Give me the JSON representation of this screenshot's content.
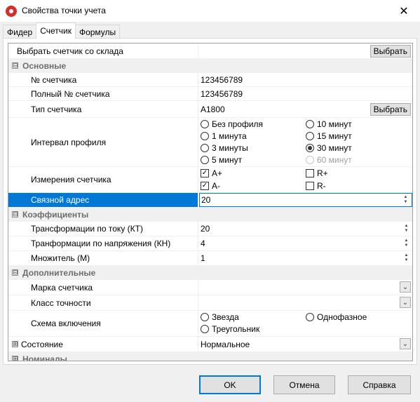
{
  "window": {
    "title": "Свойства точки учета"
  },
  "tabs": [
    {
      "label": "Фидер"
    },
    {
      "label": "Счетчик"
    },
    {
      "label": "Формулы"
    }
  ],
  "grid": {
    "select_meter": {
      "label": "Выбрать счетчик со склада",
      "button": "Выбрать"
    },
    "cat_main": {
      "label": "Основные",
      "expander": "⊟"
    },
    "meter_no": {
      "label": "№ счетчика",
      "value": "123456789"
    },
    "full_meter_no": {
      "label": "Полный № счетчика",
      "value": "123456789"
    },
    "meter_type": {
      "label": "Тип счетчика",
      "value": "A1800",
      "button": "Выбрать"
    },
    "profile_interval": {
      "label": "Интервал профиля",
      "options": [
        "Без профиля",
        "10 минут",
        "1 минута",
        "15 минут",
        "3 минуты",
        "30 минут",
        "5 минут",
        "60 минут"
      ],
      "selected": "30 минут",
      "disabled": [
        "60 минут"
      ]
    },
    "measurements": {
      "label": "Измерения счетчика",
      "options": [
        "A+",
        "R+",
        "A-",
        "R-"
      ],
      "checked": [
        "A+",
        "A-"
      ]
    },
    "comm_address": {
      "label": "Связной адрес",
      "value": "20"
    },
    "cat_coeff": {
      "label": "Коэффициенты",
      "expander": "⊟"
    },
    "ct": {
      "label": "Трансформации по току (КТ)",
      "value": "20"
    },
    "vt": {
      "label": "Транформации по напряжения (КН)",
      "value": "4"
    },
    "multiplier": {
      "label": "Множитель (М)",
      "value": "1"
    },
    "cat_extra": {
      "label": "Дополнительные",
      "expander": "⊟"
    },
    "brand": {
      "label": "Марка счетчика",
      "value": ""
    },
    "accuracy": {
      "label": "Класс точности",
      "value": ""
    },
    "wiring": {
      "label": "Схема включения",
      "options": [
        "Звезда",
        "Однофазное",
        "Треугольник"
      ],
      "selected": ""
    },
    "state": {
      "label": "Состояние",
      "value": "Нормальное",
      "expander": "⊞"
    },
    "cat_nominal": {
      "label": "Номиналы",
      "expander": "⊞"
    }
  },
  "buttons": {
    "ok": "OK",
    "cancel": "Отмена",
    "help": "Справка"
  },
  "icons": {
    "app": "app-icon",
    "close": "close-icon",
    "dropdown": "chevron-down-icon",
    "spin": "spin-icon"
  }
}
